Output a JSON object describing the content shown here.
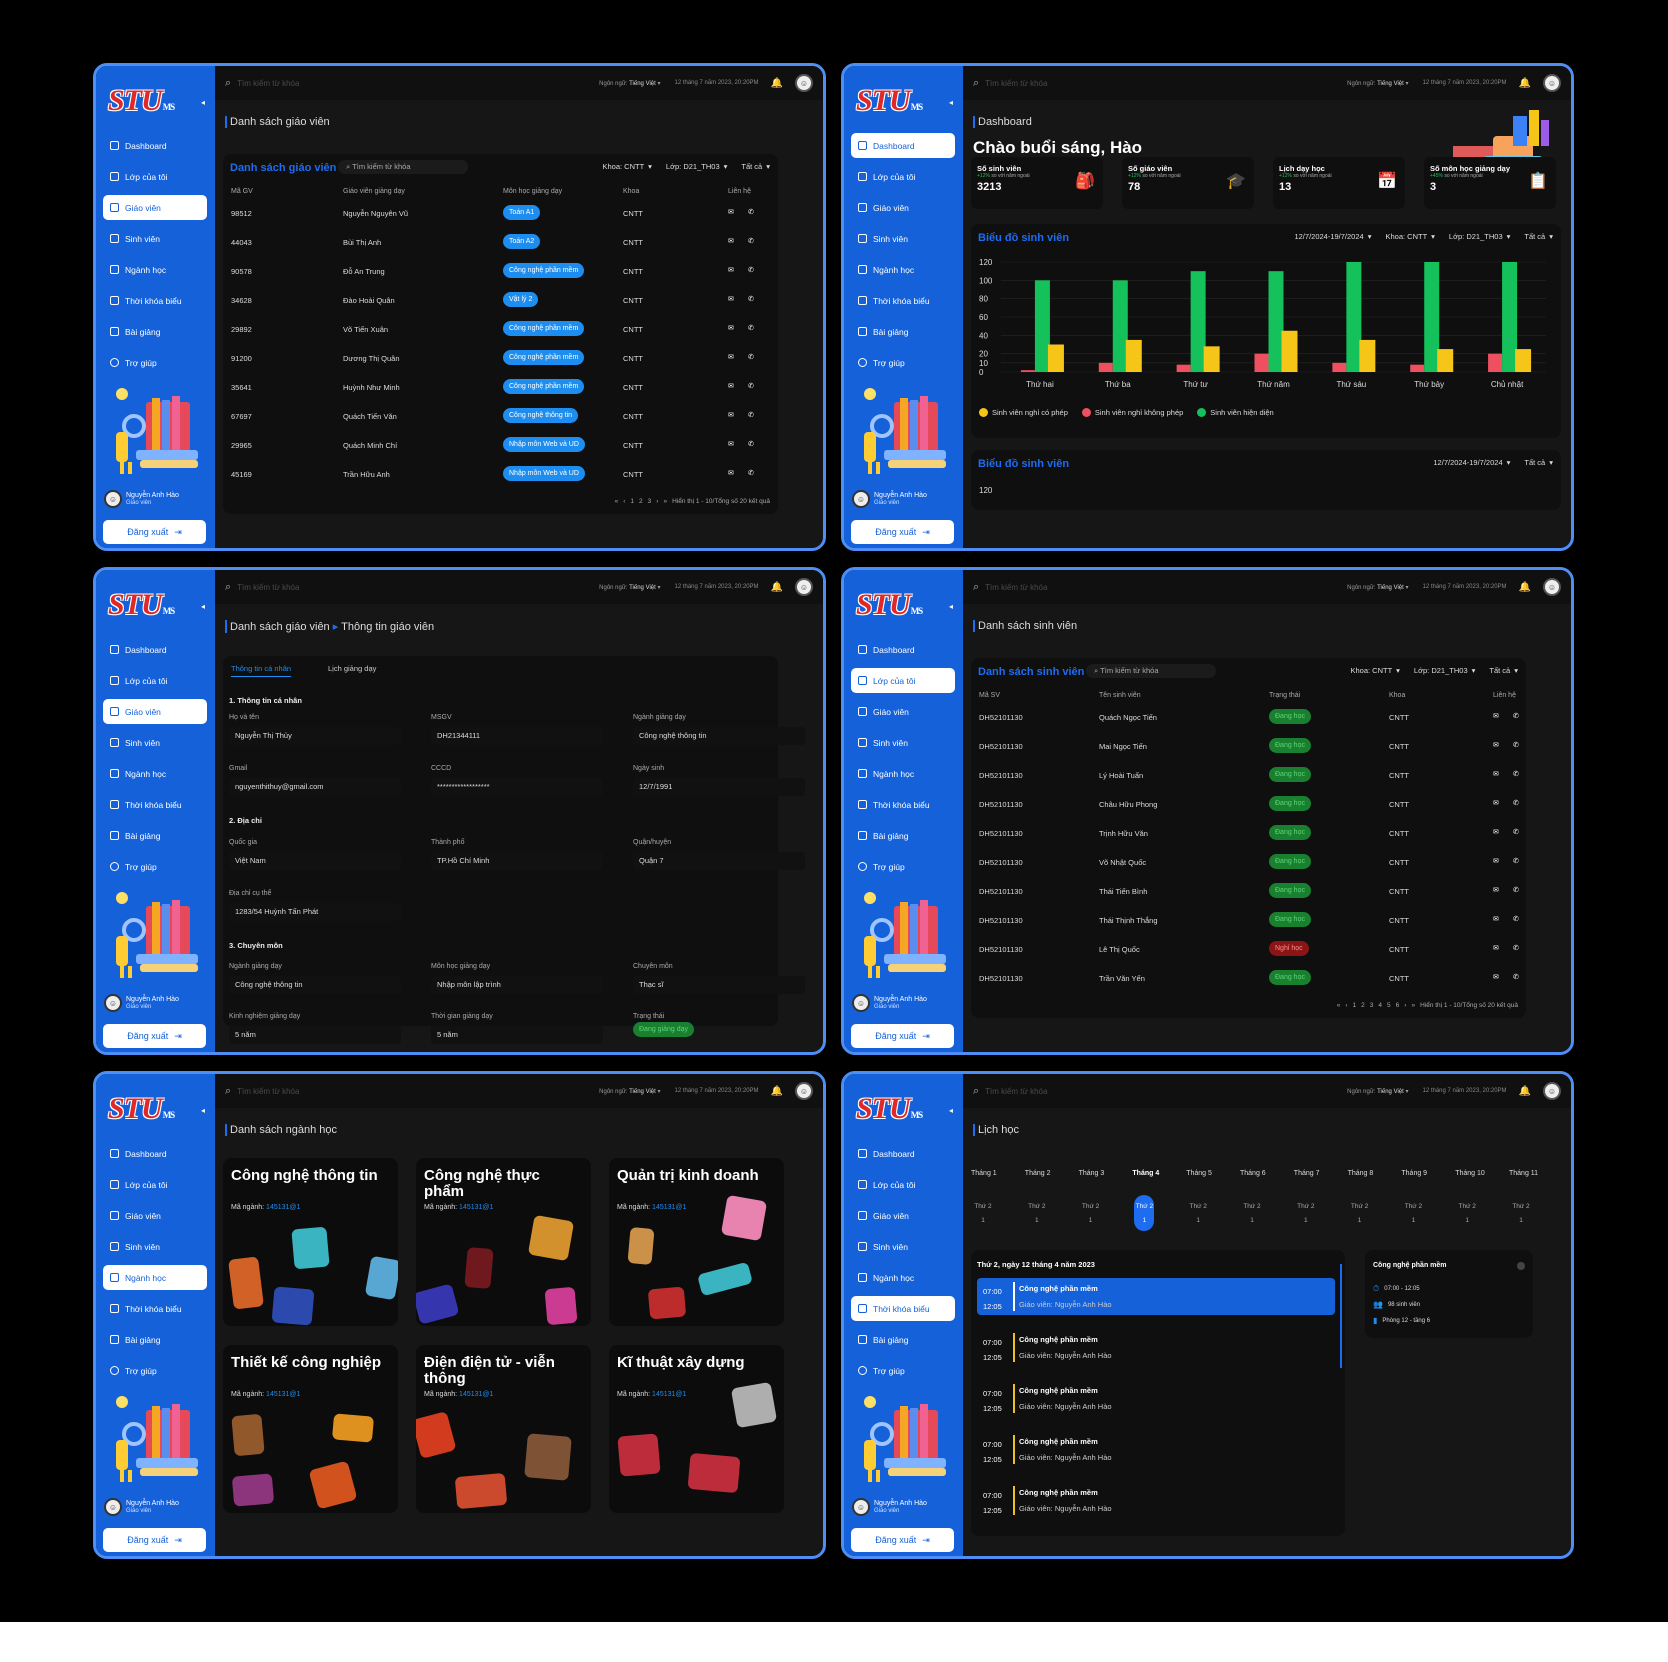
{
  "app": {
    "logo": "STU",
    "logo_sub": "MS",
    "search_placeholder": "Tìm kiếm từ khóa",
    "language_label": "Ngôn ngữ:",
    "language_value": "Tiếng Việt",
    "datetime": "12 tháng 7 năm 2023, 20:20PM",
    "user_name": "Nguyễn Anh Hào",
    "user_role": "Giáo viên",
    "logout": "Đăng xuất",
    "nav": [
      "Dashboard",
      "Lớp của tôi",
      "Giáo viên",
      "Sinh viên",
      "Ngành học",
      "Thời khóa biểu",
      "Bài giảng",
      "Trợ giúp"
    ]
  },
  "p1": {
    "title": "Danh sách giáo viên",
    "card_title": "Danh sách giáo viên",
    "search": "Tìm kiếm từ khóa",
    "filters": [
      "Khoa: CNTT",
      "Lớp: D21_TH03",
      "Tất cả"
    ],
    "headers": [
      "Mã GV",
      "Giáo viên giảng dạy",
      "Môn học giảng dạy",
      "Khoa",
      "Liên hệ"
    ],
    "rows": [
      {
        "id": "98512",
        "name": "Nguyễn Nguyên Vũ",
        "subject": "Toán A1",
        "dept": "CNTT"
      },
      {
        "id": "44043",
        "name": "Bùi Thị Anh",
        "subject": "Toán A2",
        "dept": "CNTT"
      },
      {
        "id": "90578",
        "name": "Đỗ An Trung",
        "subject": "Công nghệ phần mềm",
        "dept": "CNTT"
      },
      {
        "id": "34628",
        "name": "Đào Hoài Quân",
        "subject": "Vật lý 2",
        "dept": "CNTT"
      },
      {
        "id": "29892",
        "name": "Võ Tiến Xuân",
        "subject": "Công nghệ phần mềm",
        "dept": "CNTT"
      },
      {
        "id": "91200",
        "name": "Dương Thị Quân",
        "subject": "Công nghệ phần mềm",
        "dept": "CNTT"
      },
      {
        "id": "35641",
        "name": "Huỳnh Như Minh",
        "subject": "Công nghệ phần mềm",
        "dept": "CNTT"
      },
      {
        "id": "67697",
        "name": "Quách Tiến Văn",
        "subject": "Công nghệ thông tin",
        "dept": "CNTT"
      },
      {
        "id": "29965",
        "name": "Quách Minh Chí",
        "subject": "Nhập môn Web và UD",
        "dept": "CNTT"
      },
      {
        "id": "45169",
        "name": "Trần Hữu Anh",
        "subject": "Nhập môn Web và UD",
        "dept": "CNTT"
      }
    ],
    "pages": [
      "1",
      "2",
      "3"
    ],
    "pager_text": "Hiển thị 1 - 10/Tổng số 20 kết quả"
  },
  "p2": {
    "breadcrumb": "Dashboard",
    "greeting": "Chào buổi sáng, Hào",
    "stats": [
      {
        "title": "Số sinh viên",
        "delta": "+12%",
        "note": "so với năm ngoái",
        "value": "3213"
      },
      {
        "title": "Số giáo viên",
        "delta": "+12%",
        "note": "so với năm ngoái",
        "value": "78"
      },
      {
        "title": "Lịch dạy học",
        "delta": "+12%",
        "note": "so với năm ngoái",
        "value": "13"
      },
      {
        "title": "Số môn học giảng dạy",
        "delta": "+45%",
        "note": "so với năm ngoái",
        "value": "3"
      }
    ],
    "chart_title": "Biểu đồ sinh viên",
    "filters": [
      "12/7/2024-19/7/2024",
      "Khoa: CNTT",
      "Lớp: D21_TH03",
      "Tất cả"
    ],
    "chart2_title": "Biểu đồ sinh viên",
    "chart2_filters": [
      "12/7/2024-19/7/2024",
      "Tất cả"
    ],
    "chart2_tick": "120"
  },
  "chart_data": {
    "type": "bar",
    "categories": [
      "Thứ hai",
      "Thứ ba",
      "Thứ tư",
      "Thứ năm",
      "Thứ sáu",
      "Thứ bảy",
      "Chủ nhật"
    ],
    "ylim": [
      0,
      120
    ],
    "yticks": [
      0,
      10,
      20,
      40,
      60,
      80,
      100,
      120
    ],
    "series": [
      {
        "name": "Sinh viên nghỉ không phép",
        "color": "#ef5060",
        "values": [
          2,
          10,
          8,
          20,
          10,
          8,
          20
        ]
      },
      {
        "name": "Sinh viên hiện diện",
        "color": "#14c15a",
        "values": [
          100,
          100,
          110,
          110,
          125,
          125,
          125
        ]
      },
      {
        "name": "Sinh viên nghỉ có phép",
        "color": "#f5c518",
        "values": [
          30,
          35,
          28,
          45,
          35,
          25,
          25
        ]
      }
    ],
    "legend": [
      "Sinh viên nghỉ có phép",
      "Sinh viên nghỉ không phép",
      "Sinh viên hiện diện"
    ],
    "legend_colors": [
      "#f5c518",
      "#ef5060",
      "#14c15a"
    ]
  },
  "p3": {
    "crumb1": "Danh sách giáo viên",
    "crumb2": "Thông tin giáo viên",
    "tabs": [
      "Thông tin cá nhân",
      "Lịch giảng dạy"
    ],
    "sec1": "1. Thông tin cá nhân",
    "sec2": "2. Địa chỉ",
    "sec3": "3. Chuyên môn",
    "fields": [
      {
        "label": "Họ và tên",
        "value": "Nguyễn Thị Thủy"
      },
      {
        "label": "MSGV",
        "value": "DH21344111"
      },
      {
        "label": "Ngành giảng dạy",
        "value": "Công nghệ thông tin"
      },
      {
        "label": "Gmail",
        "value": "nguyenthithuy@gmail.com"
      },
      {
        "label": "CCCD",
        "value": "******************"
      },
      {
        "label": "Ngày sinh",
        "value": "12/7/1991"
      },
      {
        "label": "Quốc gia",
        "value": "Việt Nam"
      },
      {
        "label": "Thành phố",
        "value": "TP.Hồ Chí Minh"
      },
      {
        "label": "Quận/huyện",
        "value": "Quận 7"
      },
      {
        "label": "Địa chỉ cụ thể",
        "value": "1283/54 Huỳnh Tấn Phát"
      },
      {
        "label": "Ngành giảng dạy",
        "value": "Công nghệ thông tin"
      },
      {
        "label": "Môn học giảng dạy",
        "value": "Nhập môn lập trình"
      },
      {
        "label": "Chuyên môn",
        "value": "Thạc sĩ"
      },
      {
        "label": "Kinh nghiệm giảng dạy",
        "value": "5 năm"
      },
      {
        "label": "Thời gian giảng dạy",
        "value": "5 năm"
      },
      {
        "label": "Trạng thái",
        "value": "Đang giảng dạy"
      }
    ]
  },
  "p4": {
    "title": "Danh sách sinh viên",
    "card_title": "Danh sách sinh viên",
    "search": "Tìm kiếm từ khóa",
    "filters": [
      "Khoa: CNTT",
      "Lớp: D21_TH03",
      "Tất cả"
    ],
    "headers": [
      "Mã SV",
      "Tên sinh viên",
      "Trạng thái",
      "Khoa",
      "Liên hệ"
    ],
    "rows": [
      {
        "id": "DH52101130",
        "name": "Quách Ngọc Tiến",
        "status": "Đang học",
        "dept": "CNTT"
      },
      {
        "id": "DH52101130",
        "name": "Mai Ngọc Tiến",
        "status": "Đang học",
        "dept": "CNTT"
      },
      {
        "id": "DH52101130",
        "name": "Lý Hoài Tuấn",
        "status": "Đang học",
        "dept": "CNTT"
      },
      {
        "id": "DH52101130",
        "name": "Châu Hữu Phong",
        "status": "Đang học",
        "dept": "CNTT"
      },
      {
        "id": "DH52101130",
        "name": "Trịnh Hữu Văn",
        "status": "Đang học",
        "dept": "CNTT"
      },
      {
        "id": "DH52101130",
        "name": "Võ Nhật Quốc",
        "status": "Đang học",
        "dept": "CNTT"
      },
      {
        "id": "DH52101130",
        "name": "Thái Tiến Bình",
        "status": "Đang học",
        "dept": "CNTT"
      },
      {
        "id": "DH52101130",
        "name": "Thái Thịnh Thắng",
        "status": "Đang học",
        "dept": "CNTT"
      },
      {
        "id": "DH52101130",
        "name": "Lê Thị Quốc",
        "status": "Nghỉ học",
        "dept": "CNTT"
      },
      {
        "id": "DH52101130",
        "name": "Trần Văn Yến",
        "status": "Đang học",
        "dept": "CNTT"
      }
    ],
    "pages": [
      "1",
      "2",
      "3",
      "4",
      "5",
      "6"
    ],
    "pager_text": "Hiển thị 1 - 10/Tổng số 20 kết quả"
  },
  "p5": {
    "title": "Danh sách ngành học",
    "code_label": "Mã ngành:",
    "majors": [
      {
        "name": "Công nghệ thông tin",
        "code": "145131@1"
      },
      {
        "name": "Công nghệ thực phẩm",
        "code": "145131@1"
      },
      {
        "name": "Quản trị kinh doanh",
        "code": "145131@1"
      },
      {
        "name": "Thiết kế công nghiệp",
        "code": "145131@1"
      },
      {
        "name": "Điện điện tử - viễn thông",
        "code": "145131@1"
      },
      {
        "name": "Kĩ thuật xây dựng",
        "code": "145131@1"
      }
    ]
  },
  "p6": {
    "title": "Lịch học",
    "months": [
      "Tháng 1",
      "Tháng 2",
      "Tháng 3",
      "Tháng 4",
      "Tháng 5",
      "Tháng 6",
      "Tháng 7",
      "Tháng 8",
      "Tháng 9",
      "Tháng 10",
      "Tháng 11"
    ],
    "days": [
      "Thứ 2",
      "Thứ 2",
      "Thứ 2",
      "Thứ 2",
      "Thứ 2",
      "Thứ 2",
      "Thứ 2",
      "Thứ 2",
      "Thứ 2",
      "Thứ 2",
      "Thứ 2"
    ],
    "day_num": "1",
    "date_title": "Thứ 2, ngày 12 tháng 4 năm 2023",
    "start": "07:00",
    "end": "12:05",
    "subject": "Công nghệ phần mềm",
    "teacher": "Giáo viên: Nguyễn Anh Hào",
    "detail": {
      "title": "Công nghệ phần mềm",
      "time": "07:00 - 12:05",
      "students": "98 sinh viên",
      "room": "Phòng 12 - tầng 6"
    }
  }
}
